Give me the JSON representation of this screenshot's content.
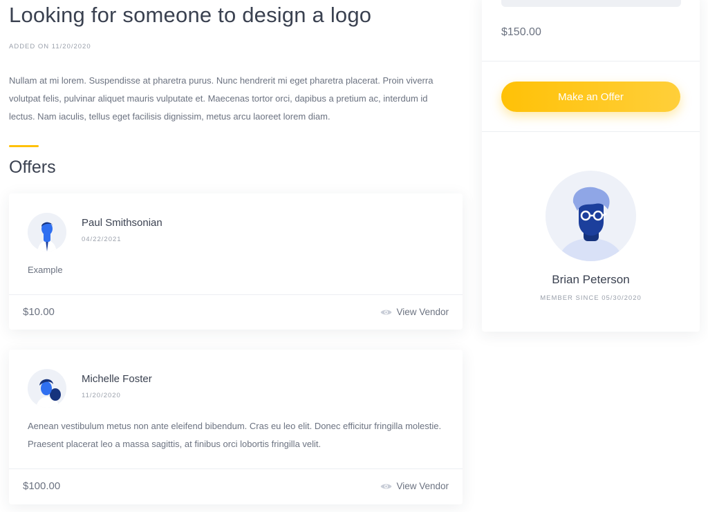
{
  "job": {
    "title": "Looking for someone to design a logo",
    "added": "ADDED ON 11/20/2020",
    "description": "Nullam at mi lorem. Suspendisse at pharetra purus. Nunc hendrerit mi eget pharetra placerat. Proin viverra volutpat felis, pulvinar aliquet mauris vulputate et. Maecenas tortor orci, dapibus a pretium ac, interdum id lectus. Nam iaculis, tellus eget facilisis dignissim, metus arcu laoreet lorem diam."
  },
  "offers_section": {
    "heading": "Offers"
  },
  "offers": [
    {
      "name": "Paul Smithsonian",
      "date": "04/22/2021",
      "text": "Example",
      "price": "$10.00",
      "view_label": "View Vendor",
      "avatar_icon": "man-avatar-icon"
    },
    {
      "name": "Michelle Foster",
      "date": "11/20/2020",
      "text": "Aenean vestibulum metus non ante eleifend bibendum. Cras eu leo elit. Donec efficitur fringilla molestie. Praesent placerat leo a massa sagittis, at finibus orci lobortis fringilla velit.",
      "price": "$100.00",
      "view_label": "View Vendor",
      "avatar_icon": "woman-avatar-icon"
    }
  ],
  "sidebar": {
    "price": "$150.00",
    "offer_button": "Make an Offer",
    "seller_name": "Brian Peterson",
    "member_since": "MEMBER SINCE 05/30/2020",
    "avatar_icon": "man-glasses-avatar-icon"
  },
  "colors": {
    "accent": "#ffc107",
    "text_dark": "#3a4150",
    "text_muted": "#6b7280",
    "avatar_blue": "#2f6ff0"
  }
}
